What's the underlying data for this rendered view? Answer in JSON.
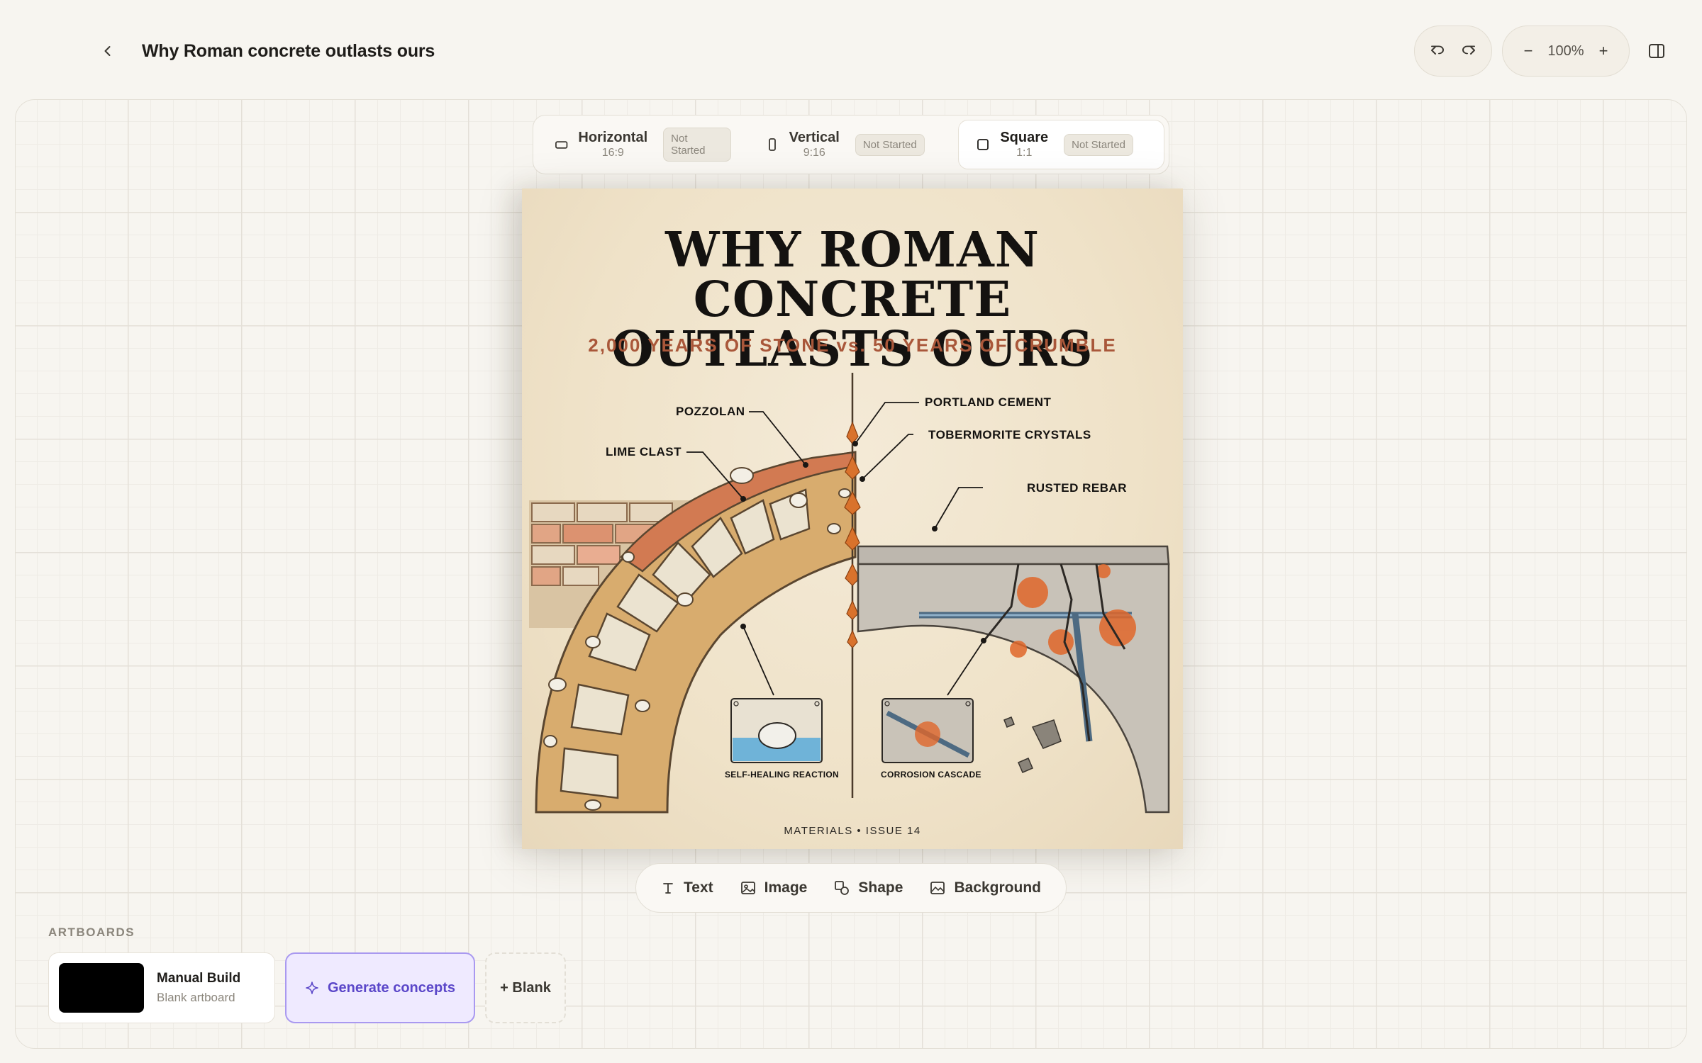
{
  "header": {
    "title": "Why Roman concrete outlasts ours",
    "zoom": "100%",
    "zoom_out": "−",
    "zoom_in": "+"
  },
  "formats": [
    {
      "name": "Horizontal",
      "ratio": "16:9",
      "status": "Not Started"
    },
    {
      "name": "Vertical",
      "ratio": "9:16",
      "status": "Not Started"
    },
    {
      "name": "Square",
      "ratio": "1:1",
      "status": "Not Started"
    }
  ],
  "artboard": {
    "title_line1": "WHY ROMAN CONCRETE",
    "title_line2": "OUTLASTS OURS",
    "subtitle": "2,000 YEARS OF STONE vs. 50 YEARS OF CRUMBLE",
    "labels": {
      "pozzolan": "POZZOLAN",
      "lime_clast": "LIME CLAST",
      "portland": "PORTLAND CEMENT",
      "tobermorite": "TOBERMORITE CRYSTALS",
      "rebar": "RUSTED REBAR",
      "self_healing": "SELF-HEALING REACTION",
      "corrosion": "CORROSION CASCADE"
    },
    "footer": "MATERIALS • ISSUE 14"
  },
  "toolbar": {
    "text": "Text",
    "image": "Image",
    "shape": "Shape",
    "background": "Background"
  },
  "artboards_panel": {
    "label": "ARTBOARDS",
    "card_name": "Manual Build",
    "card_sub": "Blank artboard",
    "generate": "Generate concepts",
    "blank": "+ Blank"
  },
  "colors": {
    "accent": "#5b47c9",
    "accent_bg": "#efeaff",
    "subtitle": "#a9573a",
    "rust": "#d9641c"
  }
}
